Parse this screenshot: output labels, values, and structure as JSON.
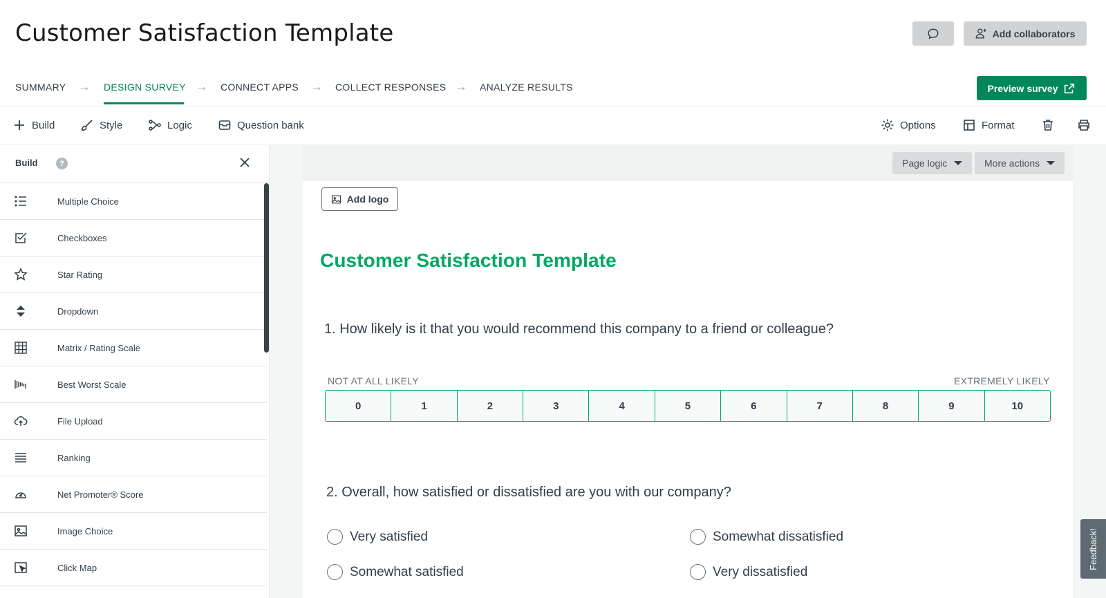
{
  "header": {
    "title": "Customer Satisfaction Template",
    "add_collaborators": "Add collaborators"
  },
  "steps": [
    {
      "label": "SUMMARY"
    },
    {
      "label": "DESIGN SURVEY"
    },
    {
      "label": "CONNECT APPS"
    },
    {
      "label": "COLLECT RESPONSES"
    },
    {
      "label": "ANALYZE RESULTS"
    }
  ],
  "preview_label": "Preview survey",
  "toolbar": {
    "build": "Build",
    "style": "Style",
    "logic": "Logic",
    "question_bank": "Question bank",
    "options": "Options",
    "format": "Format"
  },
  "sidebar": {
    "title": "Build",
    "help": "?",
    "items": [
      {
        "label": "Multiple Choice",
        "icon": "list-icon"
      },
      {
        "label": "Checkboxes",
        "icon": "checkbox-icon"
      },
      {
        "label": "Star Rating",
        "icon": "star-icon"
      },
      {
        "label": "Dropdown",
        "icon": "dropdown-icon"
      },
      {
        "label": "Matrix / Rating Scale",
        "icon": "grid-icon"
      },
      {
        "label": "Best Worst Scale",
        "icon": "best-worst-icon"
      },
      {
        "label": "File Upload",
        "icon": "cloud-upload-icon"
      },
      {
        "label": "Ranking",
        "icon": "ranking-icon"
      },
      {
        "label": "Net Promoter® Score",
        "icon": "gauge-icon"
      },
      {
        "label": "Image Choice",
        "icon": "image-icon"
      },
      {
        "label": "Click Map",
        "icon": "click-map-icon"
      }
    ]
  },
  "page_bar": {
    "page_logic": "Page logic",
    "more_actions": "More actions"
  },
  "survey": {
    "add_logo": "Add logo",
    "title": "Customer Satisfaction Template",
    "q1": {
      "text": "1. How likely is it that you would recommend this company to a friend or colleague?",
      "low_label": "NOT AT ALL LIKELY",
      "high_label": "EXTREMELY LIKELY",
      "scale": [
        "0",
        "1",
        "2",
        "3",
        "4",
        "5",
        "6",
        "7",
        "8",
        "9",
        "10"
      ]
    },
    "q2": {
      "text": "2. Overall, how satisfied or dissatisfied are you with our company?",
      "options": [
        "Very satisfied",
        "Somewhat dissatisfied",
        "Somewhat satisfied",
        "Very dissatisfied"
      ]
    }
  },
  "feedback_label": "Feedback!",
  "colors": {
    "brand_green": "#00875a",
    "title_green": "#00a862"
  }
}
